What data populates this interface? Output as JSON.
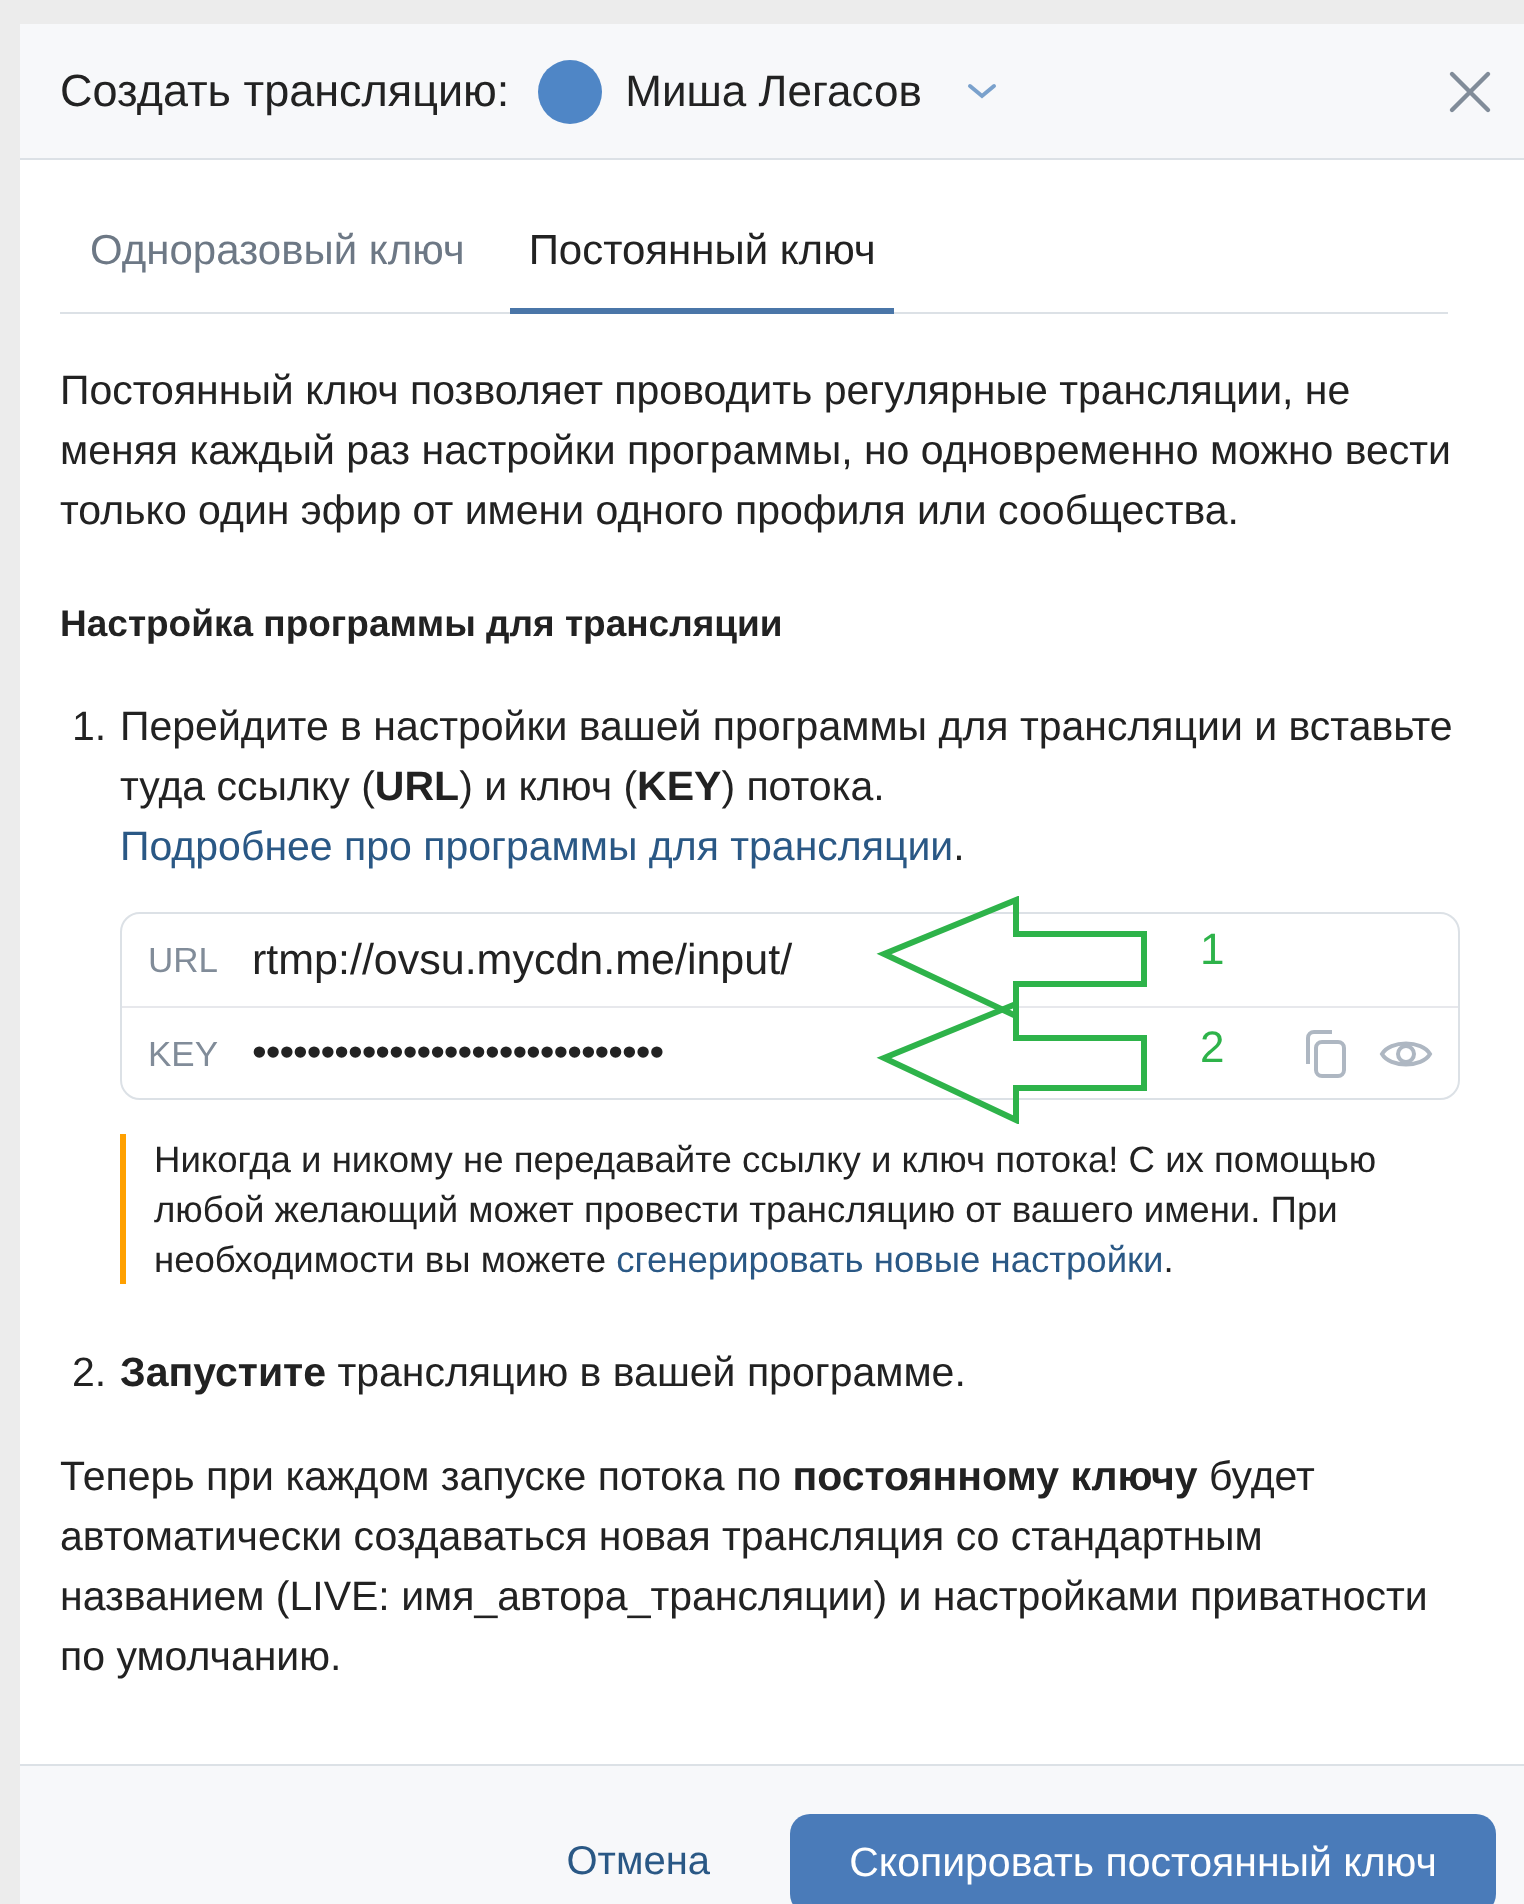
{
  "header": {
    "title": "Создать трансляцию:",
    "account_name": "Миша Легасов"
  },
  "tabs": [
    {
      "label": "Одноразовый ключ",
      "selected": false
    },
    {
      "label": "Постоянный ключ",
      "selected": true
    }
  ],
  "intro": "Постоянный ключ позволяет проводить регулярные трансляции, не меняя каждый раз настройки программы, но одновременно можно вести только один эфир от имени одного профиля или сообщества.",
  "section_title": "Настройка программы для трансляции",
  "steps": [
    {
      "number": "1.",
      "text": "Перейдите в настройки вашей программы для трансляции и вставьте туда ссылку (**URL**) и ключ (**KEY**) потока.",
      "link": "Подробнее про программы для трансляции",
      "suffix": "."
    },
    {
      "number": "2.",
      "text": "**Запустите** трансляцию в вашей программе."
    }
  ],
  "stream_fields": [
    {
      "label": "URL",
      "value": "rtmp://ovsu.mycdn.me/input/",
      "kind": "plain"
    },
    {
      "label": "KEY",
      "value": "••••••••••••••••••••••••••••••",
      "kind": "secret"
    }
  ],
  "annotations": [
    {
      "label": "1"
    },
    {
      "label": "2"
    }
  ],
  "warning": {
    "text": "Никогда и никому не передавайте ссылку и ключ потока! С их помощью любой желающий может провести трансляцию от вашего имени. При необходимости вы можете",
    "link": "сгенерировать новые настройки",
    "suffix": "."
  },
  "outro": "Теперь при каждом запуске потока по **постоянному ключу** будет автоматически создаваться новая трансляция со стандартным названием (LIVE: имя_автора_трансляции) и настройками приватности по умолчанию.",
  "buttons": {
    "cancel": "Отмена",
    "primary": "Скопировать постоянный ключ"
  }
}
